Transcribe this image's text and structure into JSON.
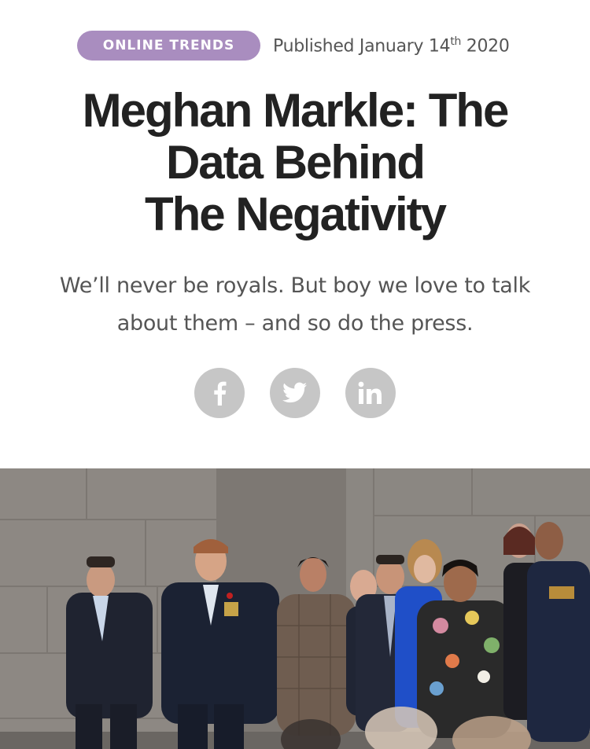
{
  "article": {
    "category": "ONLINE TRENDS",
    "published_prefix": "Published January 14",
    "published_sup": "th",
    "published_suffix": " 2020",
    "title_lines": [
      "Meghan Markle: The",
      "Data Behind",
      "The Negativity"
    ],
    "subtitle_lines": [
      "We’ll never be royals. But boy we love to talk",
      "about them – and so do the press."
    ]
  },
  "share": {
    "facebook_icon": "facebook-icon",
    "twitter_icon": "twitter-icon",
    "linkedin_icon": "linkedin-icon",
    "linkedin_label": "in",
    "facebook_label": "f"
  },
  "colors": {
    "badge": "#a98dbf",
    "share_circle": "#c6c6c6",
    "title": "#222222",
    "subtitle": "#555555"
  }
}
